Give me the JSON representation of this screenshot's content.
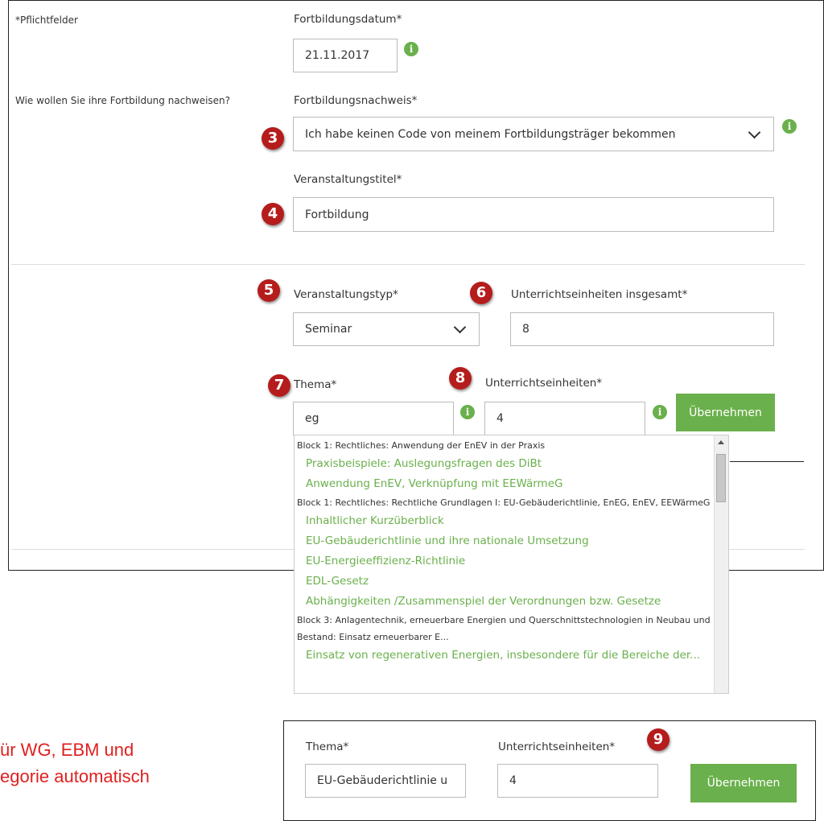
{
  "form": {
    "required_note": "*Pflichtfelder",
    "date_label": "Fortbildungsdatum*",
    "date_value": "21.11.2017",
    "proof_question": "Wie wollen Sie ihre Fortbildung nachweisen?",
    "proof_label": "Fortbildungsnachweis*",
    "proof_value": "Ich habe keinen Code von meinem Fortbildungsträger bekommen",
    "title_label": "Veranstaltungstitel*",
    "title_value": "Fortbildung",
    "type_label": "Veranstaltungstyp*",
    "type_value": "Seminar",
    "units_total_label": "Unterrichtseinheiten insgesamt*",
    "units_total_value": "8",
    "topic_label": "Thema*",
    "topic_value": "eg",
    "units_label": "Unterrichtseinheiten*",
    "units_value": "4",
    "apply_label": "Übernehmen"
  },
  "badges": [
    "3",
    "4",
    "5",
    "6",
    "7",
    "8",
    "9"
  ],
  "dropdown": {
    "groups": [
      {
        "title": "Block 1: Rechtliches: Anwendung der EnEV in der Praxis",
        "items": [
          "Praxisbeispiele: Auslegungsfragen des DiBt",
          "Anwendung EnEV, Verknüpfung mit EEWärmeG"
        ]
      },
      {
        "title": "Block 1: Rechtliches: Rechtliche Grundlagen I: EU-Gebäuderichtlinie, EnEG, EnEV, EEWärmeG",
        "items": [
          "Inhaltlicher Kurzüberblick",
          "EU-Gebäuderichtlinie und ihre nationale Umsetzung",
          "EU-Energieeffizienz-Richtlinie",
          "EDL-Gesetz",
          "Abhängigkeiten /Zusammenspiel der Verordnungen bzw. Gesetze"
        ]
      },
      {
        "title": "Block 3: Anlagentechnik, erneuerbare Energien und Querschnittstechnologien in Neubau und Bestand: Einsatz erneuerbarer E...",
        "items": [
          "Einsatz von regenerativen Energien, insbesondere für die Bereiche der..."
        ]
      }
    ]
  },
  "result": {
    "topic_label": "Thema*",
    "topic_value": "EU-Gebäuderichtlinie u",
    "units_label": "Unterrichtseinheiten*",
    "units_value": "4",
    "apply_label": "Übernehmen"
  },
  "annotation": {
    "line1": "ür WG, EBM und",
    "line2": "egorie automatisch"
  },
  "colors": {
    "accent_green": "#6ab04c",
    "badge_red": "#b51c1c",
    "note_red": "#e02020"
  },
  "icons": {
    "info": "info-icon",
    "select": "chevron-down-icon"
  }
}
